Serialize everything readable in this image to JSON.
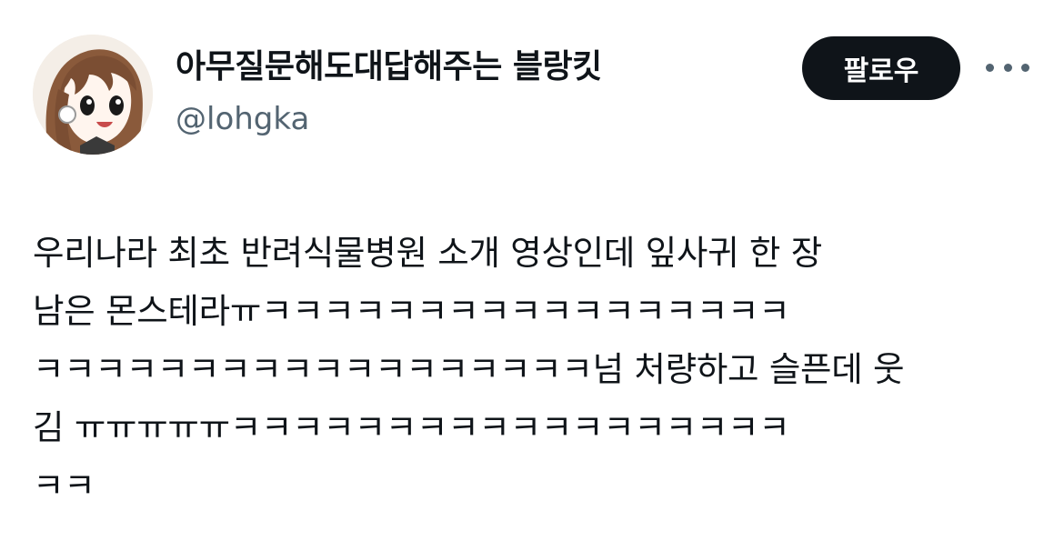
{
  "author": {
    "display_name": "아무질문해도대답해주는 블랑킷",
    "handle": "@lohgka",
    "avatar_icon": "anime-girl-avatar"
  },
  "actions": {
    "follow_label": "팔로우",
    "more_icon": "ellipsis-icon"
  },
  "tweet": {
    "lines": [
      "우리나라 최초 반려식물병원 소개 영상인데 잎사귀 한 장",
      "남은 몬스테라ㅠㅋㅋㅋㅋㅋㅋㅋㅋㅋㅋㅋㅋㅋㅋㅋㅋㅋ",
      "ㅋㅋㅋㅋㅋㅋㅋㅋㅋㅋㅋㅋㅋㅋㅋㅋㅋㅋ넘 처량하고 슬픈데 웃",
      "김 ㅠㅠㅠㅠㅠㅋㅋㅋㅋㅋㅋㅋㅋㅋㅋㅋㅋㅋㅋㅋㅋㅋㅋ",
      "ㅋㅋ"
    ]
  },
  "colors": {
    "text_primary": "#0f1419",
    "text_secondary": "#536471",
    "follow_bg": "#0f1419",
    "follow_text": "#ffffff"
  }
}
